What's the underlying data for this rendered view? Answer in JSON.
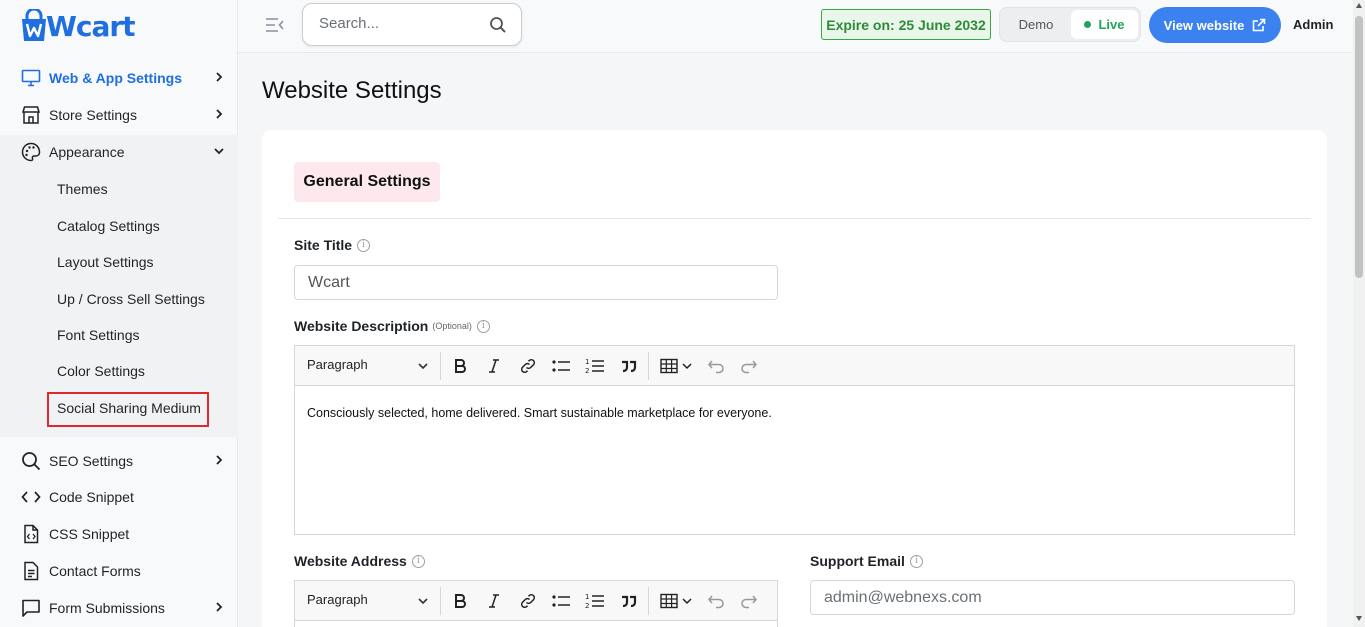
{
  "brand": {
    "logo_text": "Wcart",
    "accent": "#1f6fe0"
  },
  "header": {
    "search_placeholder": "Search...",
    "expire_label": "Expire on: 25 June 2032",
    "mode_demo": "Demo",
    "mode_live": "Live",
    "view_website": "View website",
    "user": "Admin"
  },
  "sidebar": {
    "items": [
      {
        "label": "Web & App Settings",
        "icon": "monitor-icon"
      },
      {
        "label": "Store Settings",
        "icon": "store-icon"
      },
      {
        "label": "Appearance",
        "icon": "palette-icon"
      },
      {
        "label": "SEO Settings",
        "icon": "search-icon"
      },
      {
        "label": "Code Snippet",
        "icon": "code-icon"
      },
      {
        "label": "CSS Snippet",
        "icon": "file-code-icon"
      },
      {
        "label": "Contact Forms",
        "icon": "document-icon"
      },
      {
        "label": "Form Submissions",
        "icon": "chat-icon"
      }
    ],
    "appearance_sub": [
      "Themes",
      "Catalog Settings",
      "Layout Settings",
      "Up / Cross Sell Settings",
      "Font Settings",
      "Color Settings",
      "Social Sharing Medium"
    ]
  },
  "main": {
    "page_title": "Website Settings",
    "section_tab": "General Settings",
    "site_title_label": "Site Title",
    "site_title_value": "Wcart",
    "description_label": "Website Description",
    "optional_label": "(Optional)",
    "editor_style": "Paragraph",
    "description_text": "Consciously selected, home delivered. Smart sustainable marketplace for everyone.",
    "address_label": "Website Address",
    "support_email_label": "Support Email",
    "support_email_placeholder": "admin@webnexs.com"
  }
}
